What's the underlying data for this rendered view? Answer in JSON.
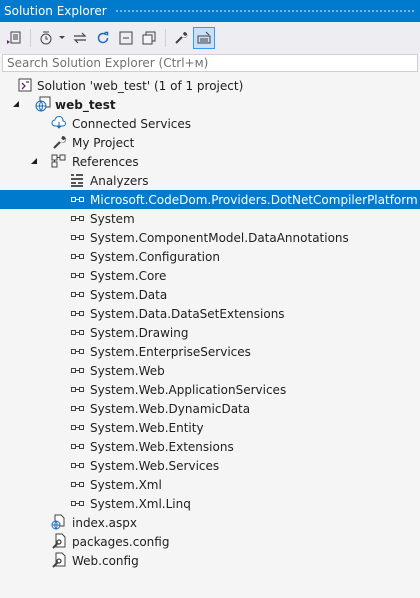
{
  "window": {
    "title": "Solution Explorer"
  },
  "toolbar": {
    "buttons": [
      {
        "name": "switch-views-icon"
      },
      {
        "name": "pending-changes-icon"
      },
      {
        "name": "sync-active-document-icon"
      },
      {
        "name": "refresh-icon"
      },
      {
        "name": "collapse-all-icon"
      },
      {
        "name": "show-all-files-icon"
      },
      {
        "name": "properties-icon"
      },
      {
        "name": "preview-selected-items-icon"
      }
    ]
  },
  "search": {
    "placeholder": "Search Solution Explorer (Ctrl+м)",
    "value": ""
  },
  "tree": {
    "solution": "Solution 'web_test' (1 of 1 project)",
    "project": "web_test",
    "connected_services": "Connected Services",
    "my_project": "My Project",
    "references": "References",
    "analyzers": "Analyzers",
    "refs": [
      "Microsoft.CodeDom.Providers.DotNetCompilerPlatform",
      "System",
      "System.ComponentModel.DataAnnotations",
      "System.Configuration",
      "System.Core",
      "System.Data",
      "System.Data.DataSetExtensions",
      "System.Drawing",
      "System.EnterpriseServices",
      "System.Web",
      "System.Web.ApplicationServices",
      "System.Web.DynamicData",
      "System.Web.Entity",
      "System.Web.Extensions",
      "System.Web.Services",
      "System.Xml",
      "System.Xml.Linq"
    ],
    "selected_ref": "Microsoft.CodeDom.Providers.DotNetCompilerPlatform",
    "files": [
      "index.aspx",
      "packages.config",
      "Web.config"
    ]
  },
  "colors": {
    "accent": "#007acc",
    "background": "#f5f5f5",
    "toolbar": "#eeeef2"
  }
}
